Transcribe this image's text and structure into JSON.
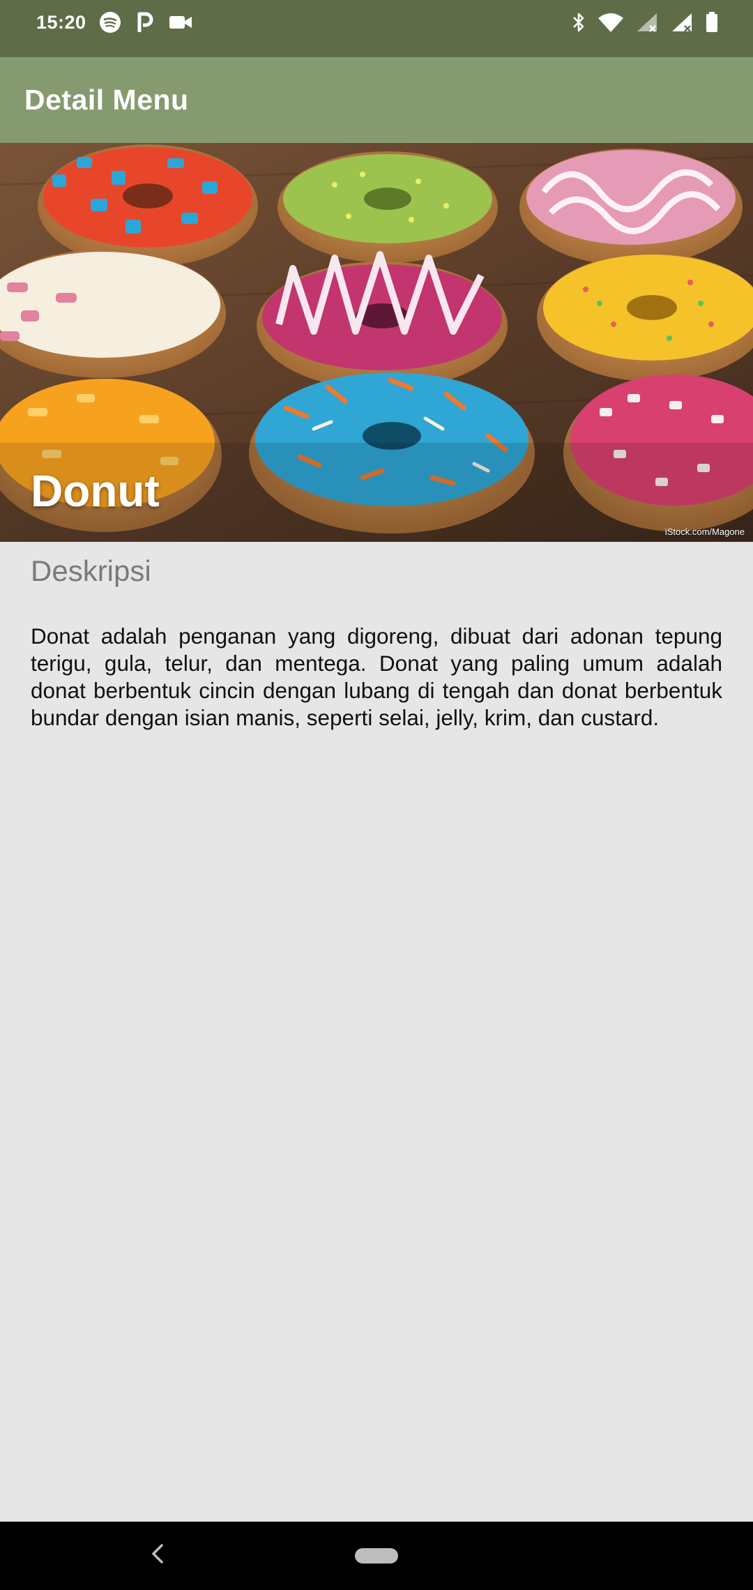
{
  "status_bar": {
    "time": "15:20",
    "left_icons": [
      "spotify-icon",
      "parking-icon",
      "video-camera-icon"
    ],
    "right_icons": [
      "bluetooth-icon",
      "wifi-icon",
      "signal-icon",
      "signal-icon",
      "battery-icon"
    ]
  },
  "app_bar": {
    "title": "Detail Menu"
  },
  "hero": {
    "title": "Donut",
    "credit": "iStock.com/Magone"
  },
  "content": {
    "heading": "Deskripsi",
    "body": "Donat adalah penganan yang digoreng, dibuat dari adonan tepung terigu, gula, telur, dan mentega. Donat yang paling umum adalah donat berbentuk cincin dengan lubang di tengah dan donat berbentuk bundar dengan isian manis, seperti selai, jelly, krim, dan custard."
  },
  "colors": {
    "status_bar": "#5e6d47",
    "app_bar": "#869a6f",
    "background": "#e7e6e6",
    "nav_bar": "#000000"
  },
  "nav_bar": {
    "icons": [
      "back-icon",
      "home-pill-icon"
    ]
  }
}
